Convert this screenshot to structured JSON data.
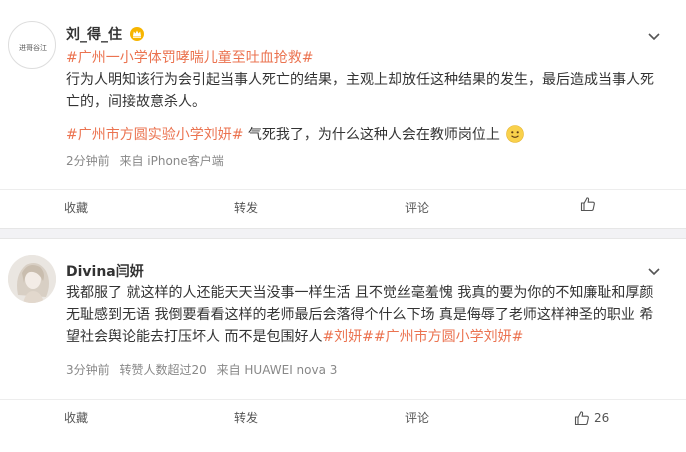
{
  "posts": [
    {
      "username": "刘_得_住",
      "avatar_text": "进哥谷江",
      "hashtag1": "#广州一小学体罚哮喘儿童至吐血抢救#",
      "body1": "行为人明知该行为会引起当事人死亡的结果，主观上却放任这种结果的发生，最后造成当事人死亡的，间接故意杀人。",
      "hashtag2_a": "#广州市方圆",
      "hashtag2_b": "实验小学刘妍",
      "hashtag2_c": "#",
      "body2": " 气死我了，为什么这种人会在教师岗位上",
      "time": "2分钟前",
      "source": "来自 iPhone客户端",
      "actions": {
        "favorite": "收藏",
        "repost": "转发",
        "comment": "评论",
        "like_count": ""
      }
    },
    {
      "username": "Divina闫妍",
      "body": "我都服了 就这样的人还能天天当没事一样生活 且不觉丝毫羞愧 我真的要为你的不知廉耻和厚颜无耻感到无语 我倒要看看这样的老师最后会落得个什么下场 真是侮辱了老师这样神圣的职业 希望社会舆论能去打压坏人 而不是包围好人",
      "hashtag1": "#刘妍#",
      "hashtag2": "#广州市方圆小学刘妍#",
      "time": "3分钟前",
      "repost_info": "转赞人数超过20",
      "source": "来自 HUAWEI nova 3",
      "actions": {
        "favorite": "收藏",
        "repost": "转发",
        "comment": "评论",
        "like_count": "26"
      }
    }
  ],
  "colors": {
    "link": "#eb7350",
    "meta": "#888888",
    "text": "#333333"
  },
  "icons": [
    "crown-icon",
    "chevron-down-icon",
    "thumbs-up-icon",
    "smile-emoji-icon"
  ]
}
